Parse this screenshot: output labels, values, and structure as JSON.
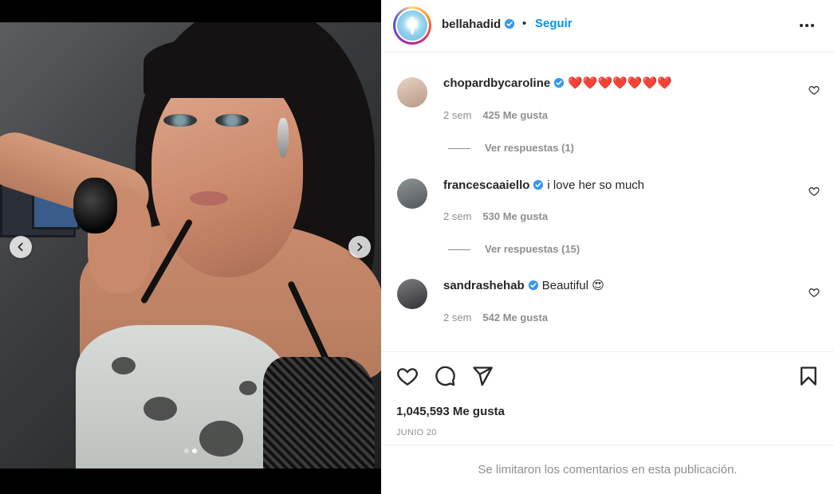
{
  "post": {
    "owner": "bellahadid",
    "separator": "•",
    "follow_label": "Seguir",
    "likes": "1,045,593 Me gusta",
    "date": "JUNIO 20",
    "comments_limited": "Se limitaron los comentarios en esta publicación."
  },
  "carousel": {
    "slides_total": 2,
    "active_index": 1
  },
  "comments": [
    {
      "username": "chopardbycaroline",
      "text": "❤️❤️❤️❤️❤️❤️❤️",
      "time": "2 sem",
      "likes": "425 Me gusta",
      "replies": "Ver respuestas (1)"
    },
    {
      "username": "francescaaiello",
      "text": "i love her so much",
      "time": "2 sem",
      "likes": "530 Me gusta",
      "replies": "Ver respuestas (15)"
    },
    {
      "username": "sandrashehab",
      "text": "Beautiful 😍",
      "time": "2 sem",
      "likes": "542 Me gusta"
    }
  ],
  "icons": {
    "prev": "chevron-left-icon",
    "next": "chevron-right-icon",
    "more": "more-horizontal-icon",
    "like": "heart-icon",
    "comment": "comment-icon",
    "share": "send-icon",
    "save": "bookmark-icon",
    "verified": "verified-badge-icon"
  },
  "colors": {
    "accent": "#0095f6",
    "text": "#262626",
    "muted": "#8e8e8e",
    "verified": "#3897f0",
    "border": "#efefef"
  }
}
